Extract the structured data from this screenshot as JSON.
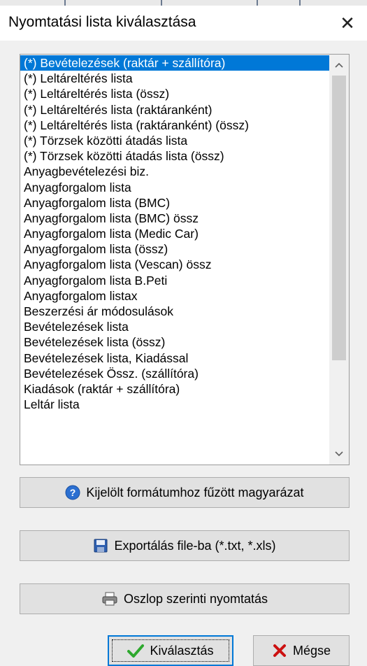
{
  "dialog": {
    "title": "Nyomtatási lista kiválasztása",
    "close_glyph": "✕"
  },
  "list": {
    "selected_index": 0,
    "items": [
      "(*) Bevételezések (raktár + szállítóra)",
      "(*) Leltáreltérés lista",
      "(*) Leltáreltérés lista (össz)",
      "(*) Leltáreltérés lista (raktáranként)",
      "(*) Leltáreltérés lista (raktáranként) (össz)",
      "(*) Törzsek közötti átadás lista",
      "(*) Törzsek közötti átadás lista (össz)",
      "Anyagbevételezési biz.",
      "Anyagforgalom lista",
      "Anyagforgalom lista (BMC)",
      "Anyagforgalom lista (BMC) össz",
      "Anyagforgalom lista (Medic Car)",
      "Anyagforgalom lista (össz)",
      "Anyagforgalom lista (Vescan) össz",
      "Anyagforgalom lista B.Peti",
      "Anyagforgalom listax",
      "Beszerzési ár módosulások",
      "Bevételezések lista",
      "Bevételezések lista (össz)",
      "Bevételezések lista, Kiadással",
      "Bevételezések Össz. (szállítóra)",
      "Kiadások (raktár + szállítóra)",
      "Leltár lista"
    ],
    "scrollbar": {
      "position_fraction": 0.0,
      "visible_fraction": 0.75
    }
  },
  "buttons": {
    "help_label": "Kijelölt formátumhoz fűzött magyarázat",
    "export_label": "Exportálás file-ba (*.txt, *.xls)",
    "print_label": "Oszlop szerinti nyomtatás",
    "select_label": "Kiválasztás",
    "cancel_label": "Mégse"
  },
  "icons": {
    "help": "help-icon",
    "export": "floppy-disk-icon",
    "print": "printer-icon",
    "select": "checkmark-icon",
    "cancel": "red-x-icon"
  },
  "colors": {
    "selection": "#0078d7",
    "help_icon": "#2b6fd1",
    "checkmark": "#2ea82e",
    "cancel_x": "#cc1111"
  }
}
